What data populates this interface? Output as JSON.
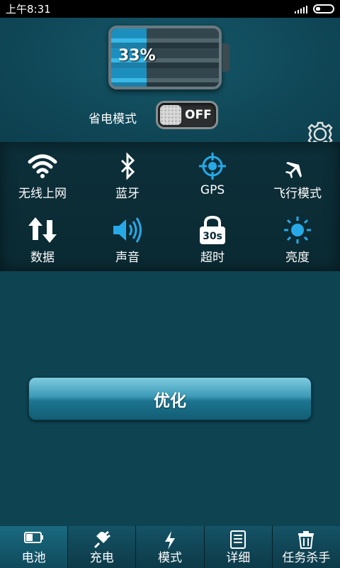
{
  "status_bar": {
    "time": "上午8:31"
  },
  "battery": {
    "percent_text": "33%",
    "level": 0.33
  },
  "power_save": {
    "label": "省电模式",
    "state": "OFF"
  },
  "quick_settings": [
    {
      "label": "无线上网",
      "icon": "wifi-icon"
    },
    {
      "label": "蓝牙",
      "icon": "bluetooth-icon"
    },
    {
      "label": "GPS",
      "icon": "gps-icon"
    },
    {
      "label": "飞行模式",
      "icon": "airplane-icon"
    },
    {
      "label": "数据",
      "icon": "data-arrows-icon"
    },
    {
      "label": "声音",
      "icon": "speaker-icon"
    },
    {
      "label": "超时",
      "icon": "lock-timeout-icon",
      "icon_text": "30s"
    },
    {
      "label": "亮度",
      "icon": "brightness-icon"
    }
  ],
  "optimize_button": {
    "label": "优化"
  },
  "tabs": [
    {
      "label": "电池",
      "icon": "battery-icon",
      "active": true
    },
    {
      "label": "充电",
      "icon": "plug-icon"
    },
    {
      "label": "模式",
      "icon": "bolt-icon"
    },
    {
      "label": "详细",
      "icon": "document-icon"
    },
    {
      "label": "任务杀手",
      "icon": "trash-icon"
    }
  ],
  "colors": {
    "accent": "#1e9fd4",
    "background": "#0e4352",
    "icon_blue": "#27a9e8"
  }
}
